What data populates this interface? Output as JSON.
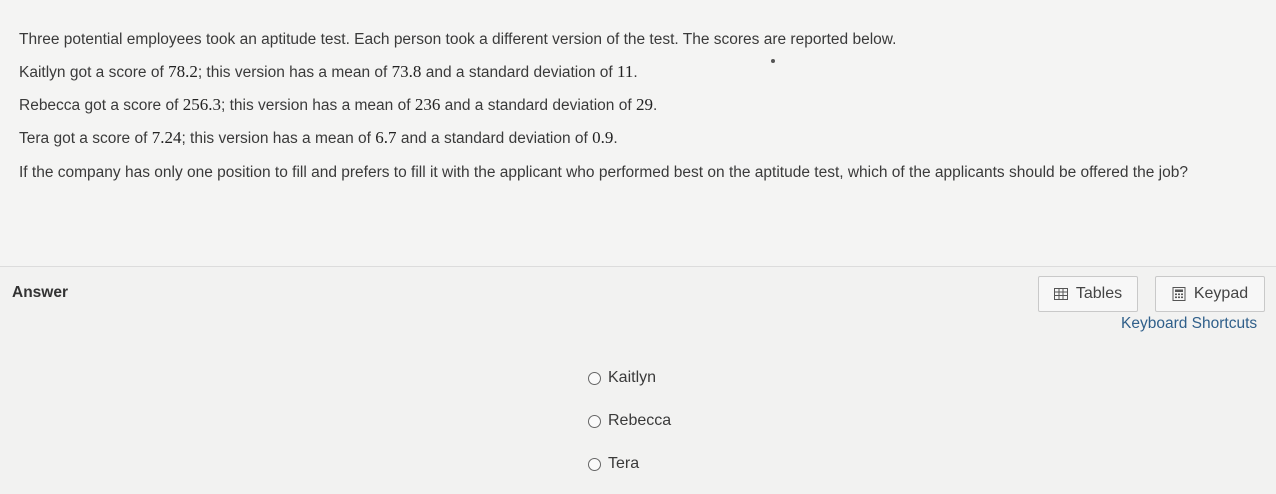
{
  "question": {
    "intro": "Three potential employees took an aptitude test. Each person took a different version of the test. The scores are reported below.",
    "lines": [
      {
        "a": "Kaitlyn got a score of ",
        "score": "78.2",
        "b": "; this version has a mean of ",
        "mean": "73.8",
        "c": " and a standard deviation of ",
        "sd": "11",
        "d": "."
      },
      {
        "a": "Rebecca got a score of ",
        "score": "256.3",
        "b": "; this version has a mean of ",
        "mean": "236",
        "c": " and a standard deviation of ",
        "sd": "29",
        "d": "."
      },
      {
        "a": "Tera got a score of ",
        "score": "7.24",
        "b": "; this version has a mean of ",
        "mean": "6.7",
        "c": " and a standard deviation of ",
        "sd": "0.9",
        "d": "."
      }
    ],
    "prompt": "If the company has only one position to fill and prefers to fill it with the applicant who performed best on the aptitude test, which of the applicants should be offered the job?"
  },
  "answer": {
    "label": "Answer",
    "tables_label": "Tables",
    "keypad_label": "Keypad",
    "shortcuts_label": "Keyboard Shortcuts",
    "options": [
      "Kaitlyn",
      "Rebecca",
      "Tera"
    ]
  },
  "icons": {
    "tables": "table-grid-icon",
    "keypad": "calculator-icon",
    "radio": "radio-unchecked"
  },
  "colors": {
    "link": "#2f5f8a",
    "background": "#f2f2f1"
  }
}
